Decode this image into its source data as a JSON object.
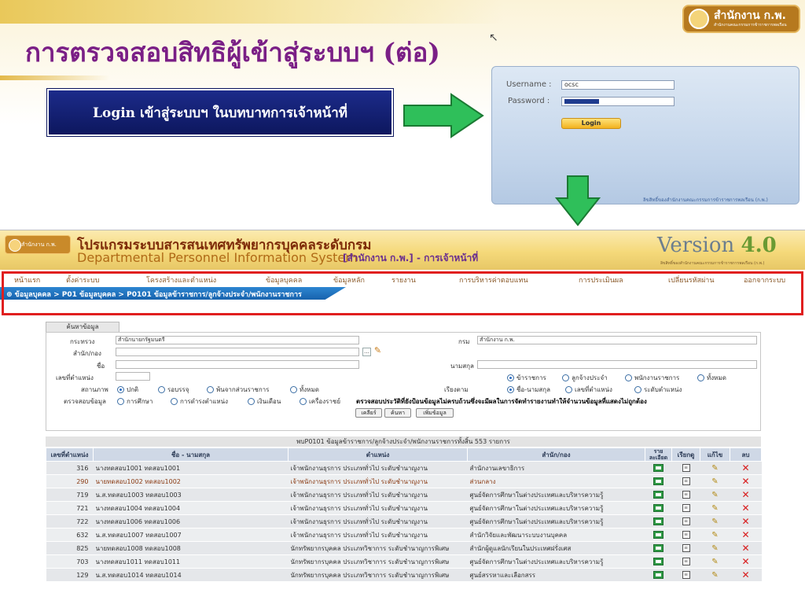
{
  "slide": {
    "title": "การตรวจสอบสิทธิผู้เข้าสู่ระบบฯ (ต่อ)",
    "instruction": "Login เข้าสู่ระบบฯ ในบทบาทการเจ้าหน้าที่",
    "badge": {
      "name": "สำนักงาน ก.พ.",
      "subtitle": "สำนักงานคณะกรรมการข้าราชการพลเรือน"
    },
    "colors": {
      "title": "#7a1f86",
      "box": "#1c2b8a",
      "arrow": "#2fbf5a"
    }
  },
  "login": {
    "username_label": "Username :",
    "username_value": "ocsc",
    "password_label": "Password :",
    "button": "Login",
    "footer": "ลิขสิทธิ์ของสำนักงานคณะกรรมการข้าราชการพลเรือน (ก.พ.)"
  },
  "app": {
    "logo_text": "สำนักงาน ก.พ.",
    "title_th": "โปรแกรมระบบสารสนเทศทรัพยากรบุคคลระดับกรม",
    "title_en": "Departmental Personnel Information System",
    "role": "[สำนักงาน ก.พ.] - การเจ้าหน้าที่",
    "version_word": "Version",
    "version_num": "4.0",
    "version_sub": "ลิขสิทธิ์ของสำนักงานคณะกรรมการข้าราชการพลเรือน (ก.พ.)",
    "menu": [
      "หน้าแรก",
      "ตั้งค่าระบบ",
      "โครงสร้างและตำแหน่ง",
      "ข้อมูลบุคคล",
      "ข้อมูลหลัก",
      "รายงาน",
      "การบริหารค่าตอบแทน",
      "การประเมินผล",
      "เปลี่ยนรหัสผ่าน",
      "ออกจากระบบ"
    ],
    "breadcrumb": "⊕ ข้อมูลบุคคล > P01 ข้อมูลบุคคล > P0101 ข้อมูลข้าราชการ/ลูกจ้างประจำ/พนักงานราชการ"
  },
  "search": {
    "tab": "ค้นหาข้อมูล",
    "ministry_label": "กระทรวง",
    "ministry_value": "สำนักนายกรัฐมนตรี",
    "department_label": "กรม",
    "department_value": "สำนักงาน ก.พ.",
    "office_label": "สำนัก/กอง",
    "name_label": "ชื่อ",
    "surname_label": "นามสกุล",
    "position_no_label": "เลขที่ตำแหน่ง",
    "type_radios": [
      "ข้าราชการ",
      "ลูกจ้างประจำ",
      "พนักงานราชการ",
      "ทั้งหมด"
    ],
    "status_label": "สถานภาพ",
    "status_radios": [
      "ปกติ",
      "รอบรรจุ",
      "พ้นจากส่วนราชการ",
      "ทั้งหมด"
    ],
    "sort_label": "เรียงตาม",
    "sort_radios": [
      "ชื่อ-นามสกุล",
      "เลขที่ตำแหน่ง",
      "ระดับตำแหน่ง"
    ],
    "check_label": "ตรวจสอบข้อมูล",
    "check_radios": [
      "การศึกษา",
      "การดำรงตำแหน่ง",
      "เงินเดือน",
      "เครื่องราชย์"
    ],
    "warning": "ตรวจสอบประวัติที่ยังป้อนข้อมูลไม่ครบถ้วนซึ่งจะมีผลในการจัดทำรายงานทำให้จำนวนข้อมูลที่แสดงไม่ถูกต้อง",
    "buttons": {
      "clear": "เคลียร์",
      "search": "ค้นหา",
      "add": "เพิ่มข้อมูล"
    }
  },
  "results": {
    "caption": "พบP0101 ข้อมูลข้าราชการ/ลูกจ้างประจำ/พนักงานราชการทั้งสิ้น 553 รายการ",
    "columns": [
      "เลขที่ตำแหน่ง",
      "ชื่อ - นามสกุล",
      "ตำแหน่ง",
      "สำนัก/กอง",
      "ราย ละเอียด",
      "เรียกดู",
      "แก้ไข",
      "ลบ"
    ],
    "rows": [
      [
        "316",
        "นางทดสอบ1001 ทดสอบ1001",
        "เจ้าพนักงานธุรการ ประเภททั่วไป ระดับชำนาญงาน",
        "สำนักงานเลขาธิการ"
      ],
      [
        "290",
        "นายทดสอบ1002 ทดสอบ1002",
        "เจ้าพนักงานธุรการ ประเภททั่วไป ระดับชำนาญงาน",
        "ส่วนกลาง"
      ],
      [
        "719",
        "น.ส.ทดสอบ1003 ทดสอบ1003",
        "เจ้าพนักงานธุรการ ประเภททั่วไป ระดับชำนาญงาน",
        "ศูนย์จัดการศึกษาในต่างประเทศและบริหารความรู้"
      ],
      [
        "721",
        "นางทดสอบ1004 ทดสอบ1004",
        "เจ้าพนักงานธุรการ ประเภททั่วไป ระดับชำนาญงาน",
        "ศูนย์จัดการศึกษาในต่างประเทศและบริหารความรู้"
      ],
      [
        "722",
        "นางทดสอบ1006 ทดสอบ1006",
        "เจ้าพนักงานธุรการ ประเภททั่วไป ระดับชำนาญงาน",
        "ศูนย์จัดการศึกษาในต่างประเทศและบริหารความรู้"
      ],
      [
        "632",
        "น.ส.ทดสอบ1007 ทดสอบ1007",
        "เจ้าพนักงานธุรการ ประเภททั่วไป ระดับชำนาญงาน",
        "สำนักวิจัยและพัฒนาระบบงานบุคคล"
      ],
      [
        "825",
        "นายทดสอบ1008 ทดสอบ1008",
        "นักทรัพยากรบุคคล ประเภทวิชาการ ระดับชำนาญการพิเศษ",
        "สำนักผู้ดูแลนักเรียนในประเทศฝรั่งเศส"
      ],
      [
        "703",
        "นางทดสอบ1011 ทดสอบ1011",
        "นักทรัพยากรบุคคล ประเภทวิชาการ ระดับชำนาญการพิเศษ",
        "ศูนย์จัดการศึกษาในต่างประเทศและบริหารความรู้"
      ],
      [
        "129",
        "น.ส.ทดสอบ1014 ทดสอบ1014",
        "นักทรัพยากรบุคคล ประเภทวิชาการ ระดับชำนาญการพิเศษ",
        "ศูนย์สรรหาและเลือกสรร"
      ]
    ],
    "highlight_row": 1,
    "row_icons": [
      "detail-icon",
      "view-icon",
      "edit-icon",
      "delete-icon"
    ]
  }
}
